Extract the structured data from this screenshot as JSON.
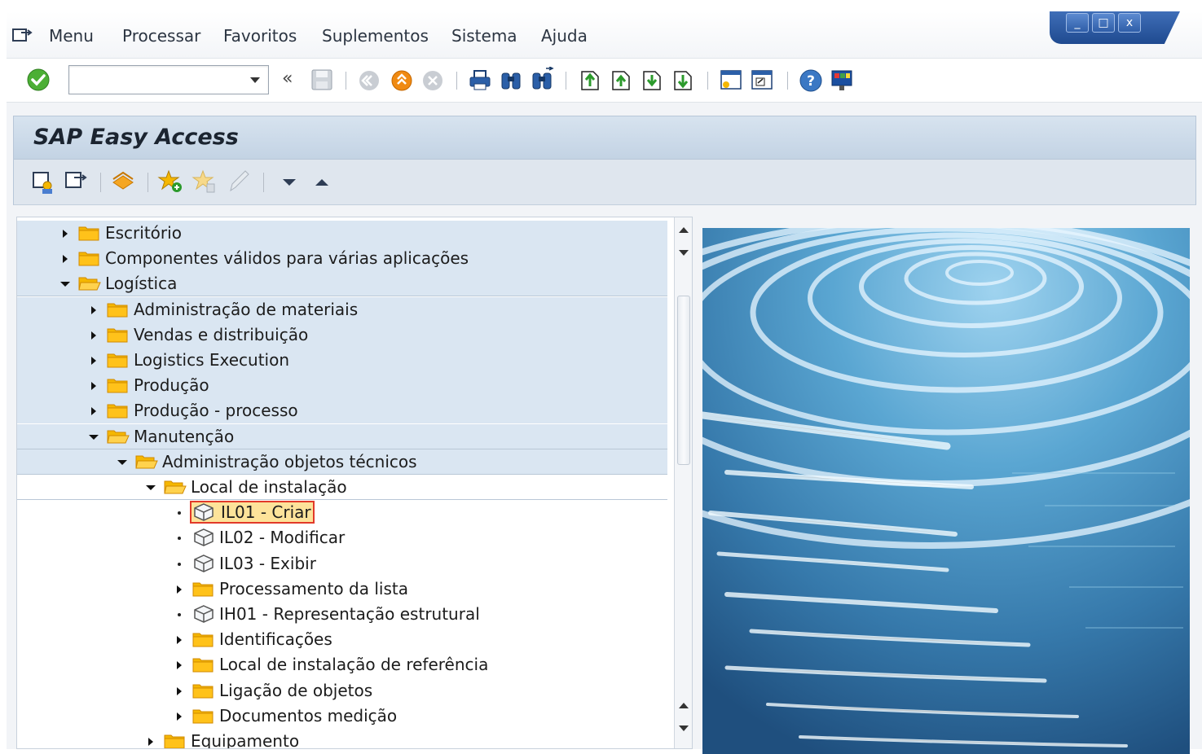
{
  "menubar": {
    "items": [
      "Menu",
      "Processar",
      "Favoritos",
      "Suplementos",
      "Sistema",
      "Ajuda"
    ]
  },
  "window_controls": {
    "minimize": "_",
    "maximize": "□",
    "close": "x"
  },
  "toolbar": {
    "command_value": "",
    "back_double": "«"
  },
  "screen": {
    "title": "SAP Easy Access"
  },
  "tree": {
    "rows": [
      {
        "label": "Escritório",
        "level": 0,
        "kind": "folder",
        "state": "collapsed"
      },
      {
        "label": "Componentes válidos para várias aplicações",
        "level": 0,
        "kind": "folder",
        "state": "collapsed"
      },
      {
        "label": "Logística",
        "level": 0,
        "kind": "folder",
        "state": "expanded"
      },
      {
        "label": "Administração de materiais",
        "level": 1,
        "kind": "folder",
        "state": "collapsed"
      },
      {
        "label": "Vendas e distribuição",
        "level": 1,
        "kind": "folder",
        "state": "collapsed"
      },
      {
        "label": "Logistics Execution",
        "level": 1,
        "kind": "folder",
        "state": "collapsed"
      },
      {
        "label": "Produção",
        "level": 1,
        "kind": "folder",
        "state": "collapsed"
      },
      {
        "label": "Produção - processo",
        "level": 1,
        "kind": "folder",
        "state": "collapsed"
      },
      {
        "label": "Manutenção",
        "level": 1,
        "kind": "folder",
        "state": "expanded"
      },
      {
        "label": "Administração objetos técnicos",
        "level": 2,
        "kind": "folder",
        "state": "expanded"
      },
      {
        "label": "Local de instalação",
        "level": 3,
        "kind": "folder",
        "state": "expanded"
      },
      {
        "label": "IL01 - Criar",
        "level": 4,
        "kind": "transaction",
        "state": "leaf",
        "selected": true
      },
      {
        "label": "IL02 - Modificar",
        "level": 4,
        "kind": "transaction",
        "state": "leaf"
      },
      {
        "label": "IL03 - Exibir",
        "level": 4,
        "kind": "transaction",
        "state": "leaf"
      },
      {
        "label": "Processamento da lista",
        "level": 4,
        "kind": "folder",
        "state": "collapsed"
      },
      {
        "label": "IH01 - Representação estrutural",
        "level": 4,
        "kind": "transaction",
        "state": "leaf"
      },
      {
        "label": "Identificações",
        "level": 4,
        "kind": "folder",
        "state": "collapsed"
      },
      {
        "label": "Local de instalação de referência",
        "level": 4,
        "kind": "folder",
        "state": "collapsed"
      },
      {
        "label": "Ligação de objetos",
        "level": 4,
        "kind": "folder",
        "state": "collapsed"
      },
      {
        "label": "Documentos medição",
        "level": 4,
        "kind": "folder",
        "state": "collapsed"
      },
      {
        "label": "Equipamento",
        "level": 3,
        "kind": "folder",
        "state": "collapsed"
      }
    ]
  },
  "colors": {
    "folder": "#f5b700",
    "folder_border": "#d08a00",
    "selection_fill": "#fde39a",
    "selection_border": "#e23a2a",
    "row_highlight": "#dae6f2",
    "title_band": "#c9d8e8"
  },
  "icons": [
    "menu-toggle-icon",
    "enter-icon",
    "save-icon",
    "back-icon",
    "exit-icon",
    "cancel-icon",
    "print-icon",
    "find-icon",
    "find-next-icon",
    "first-page-icon",
    "previous-page-icon",
    "next-page-icon",
    "last-page-icon",
    "new-session-icon",
    "shortcut-icon",
    "help-icon",
    "customize-layout-icon",
    "user-menu-icon",
    "sap-menu-icon",
    "other-menu-icon",
    "add-favorite-icon",
    "delete-favorite-icon",
    "change-favorite-icon",
    "expand-icon",
    "collapse-icon"
  ]
}
